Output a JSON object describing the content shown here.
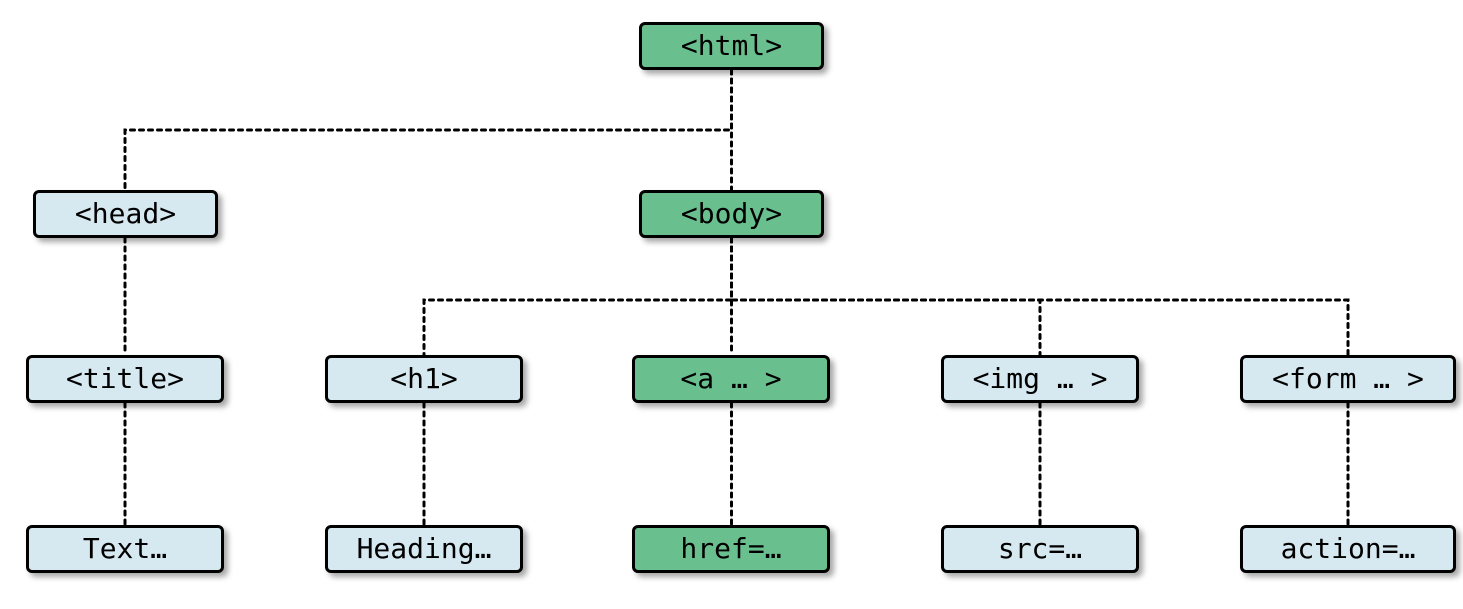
{
  "chart_data": {
    "type": "tree",
    "title": "",
    "nodes": [
      {
        "id": "html",
        "label": "<html>",
        "parent": null,
        "highlighted": true
      },
      {
        "id": "head",
        "label": "<head>",
        "parent": "html",
        "highlighted": false
      },
      {
        "id": "body",
        "label": "<body>",
        "parent": "html",
        "highlighted": true
      },
      {
        "id": "title",
        "label": "<title>",
        "parent": "head",
        "highlighted": false
      },
      {
        "id": "h1",
        "label": "<h1>",
        "parent": "body",
        "highlighted": false
      },
      {
        "id": "a",
        "label": "<a … >",
        "parent": "body",
        "highlighted": true
      },
      {
        "id": "img",
        "label": "<img … >",
        "parent": "body",
        "highlighted": false
      },
      {
        "id": "form",
        "label": "<form … >",
        "parent": "body",
        "highlighted": false
      },
      {
        "id": "text",
        "label": "Text…",
        "parent": "title",
        "highlighted": false
      },
      {
        "id": "heading",
        "label": "Heading…",
        "parent": "h1",
        "highlighted": false
      },
      {
        "id": "href",
        "label": "href=…",
        "parent": "a",
        "highlighted": true
      },
      {
        "id": "src",
        "label": "src=…",
        "parent": "img",
        "highlighted": false
      },
      {
        "id": "action",
        "label": "action=…",
        "parent": "form",
        "highlighted": false
      }
    ],
    "colors": {
      "default": "#d6e9f0",
      "highlighted": "#69bf8e",
      "border": "#000000"
    },
    "edge_style": "dotted"
  },
  "nodes": {
    "html": "<html>",
    "head": "<head>",
    "body": "<body>",
    "title": "<title>",
    "h1": "<h1>",
    "a": "<a … >",
    "img": "<img … >",
    "form": "<form … >",
    "text": "Text…",
    "heading": "Heading…",
    "href": "href=…",
    "src": "src=…",
    "action": "action=…"
  }
}
